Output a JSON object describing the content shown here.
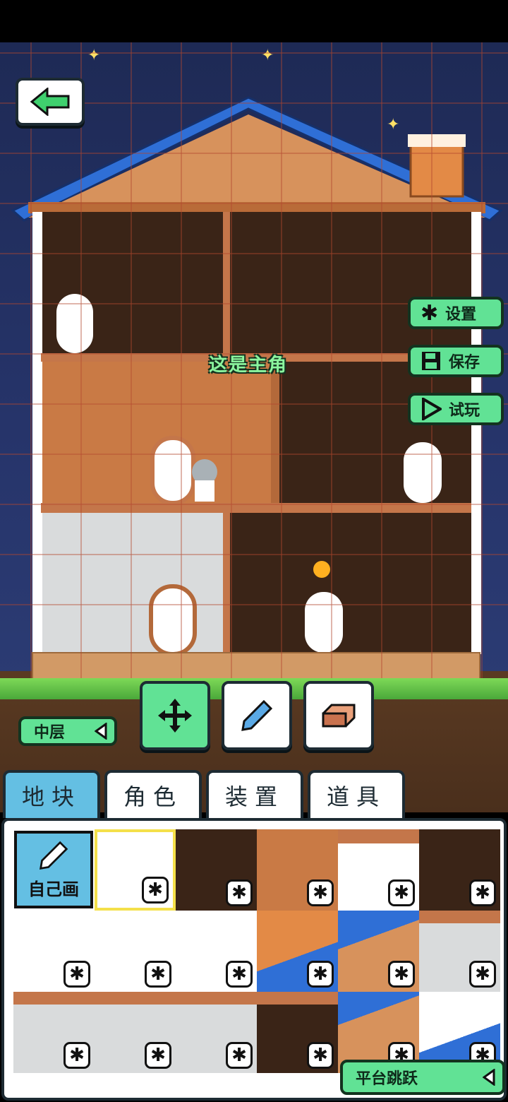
{
  "top_controls": {
    "back_icon": "arrow-left-icon",
    "side_buttons": [
      {
        "label": "设置",
        "icon": "gear-icon"
      },
      {
        "label": "保存",
        "icon": "floppy-disk-icon"
      },
      {
        "label": "试玩",
        "icon": "play-icon"
      }
    ]
  },
  "scene": {
    "hero_label": "这是主角"
  },
  "toolbar": {
    "layer_selector": "中层",
    "tools": [
      {
        "name": "move",
        "icon": "move-arrows-icon",
        "active": true
      },
      {
        "name": "pencil",
        "icon": "pencil-icon",
        "active": false
      },
      {
        "name": "eraser",
        "icon": "eraser-icon",
        "active": false
      }
    ]
  },
  "tabs": [
    {
      "label": "地块",
      "active": true
    },
    {
      "label": "角色",
      "active": false
    },
    {
      "label": "装置",
      "active": false
    },
    {
      "label": "道具",
      "active": false
    }
  ],
  "palette": {
    "draw_tile_label": "自己画",
    "mode_selector": "平台跳跃"
  },
  "colors": {
    "accent_green": "#61e295",
    "tab_active_blue": "#64bfe3",
    "roof_blue": "#2f6fd6",
    "wood": "#c97a45"
  }
}
